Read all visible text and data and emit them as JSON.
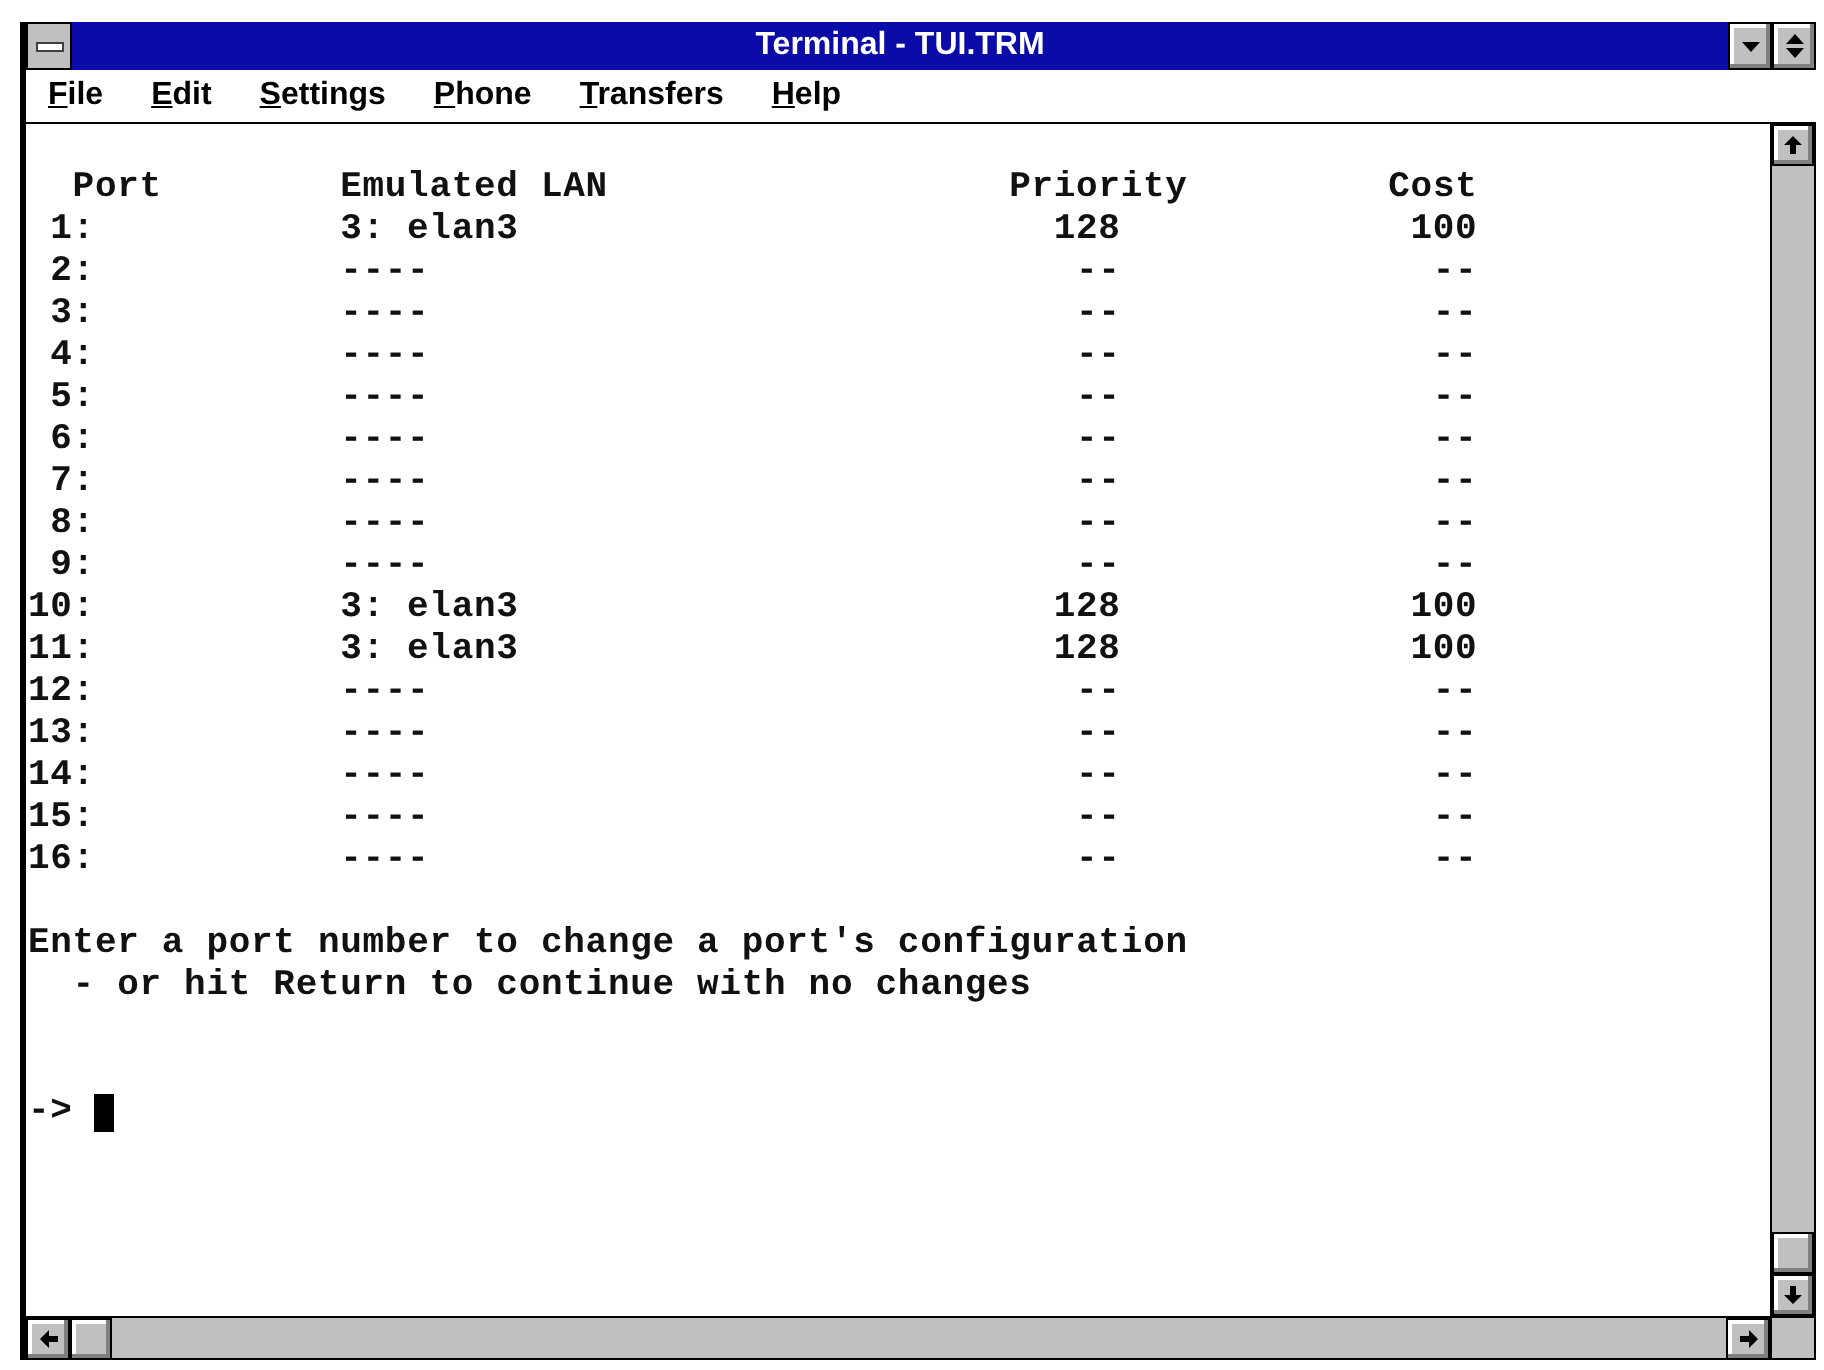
{
  "window": {
    "title": "Terminal - TUI.TRM"
  },
  "menu": [
    "File",
    "Edit",
    "Settings",
    "Phone",
    "Transfers",
    "Help"
  ],
  "table": {
    "columns": [
      "Port",
      "Emulated LAN",
      "Priority",
      "Cost"
    ],
    "rows": [
      [
        "1:",
        "3: elan3",
        "128",
        "100"
      ],
      [
        "2:",
        "----",
        "--",
        "--"
      ],
      [
        "3:",
        "----",
        "--",
        "--"
      ],
      [
        "4:",
        "----",
        "--",
        "--"
      ],
      [
        "5:",
        "----",
        "--",
        "--"
      ],
      [
        "6:",
        "----",
        "--",
        "--"
      ],
      [
        "7:",
        "----",
        "--",
        "--"
      ],
      [
        "8:",
        "----",
        "--",
        "--"
      ],
      [
        "9:",
        "----",
        "--",
        "--"
      ],
      [
        "10:",
        "3: elan3",
        "128",
        "100"
      ],
      [
        "11:",
        "3: elan3",
        "128",
        "100"
      ],
      [
        "12:",
        "----",
        "--",
        "--"
      ],
      [
        "13:",
        "----",
        "--",
        "--"
      ],
      [
        "14:",
        "----",
        "--",
        "--"
      ],
      [
        "15:",
        "----",
        "--",
        "--"
      ],
      [
        "16:",
        "----",
        "--",
        "--"
      ]
    ]
  },
  "message": [
    {
      "text": "Enter a port number to change a port's configuration",
      "indented": false
    },
    {
      "text": "- or hit Return to continue with no changes",
      "indented": true
    }
  ],
  "prompt": "->"
}
